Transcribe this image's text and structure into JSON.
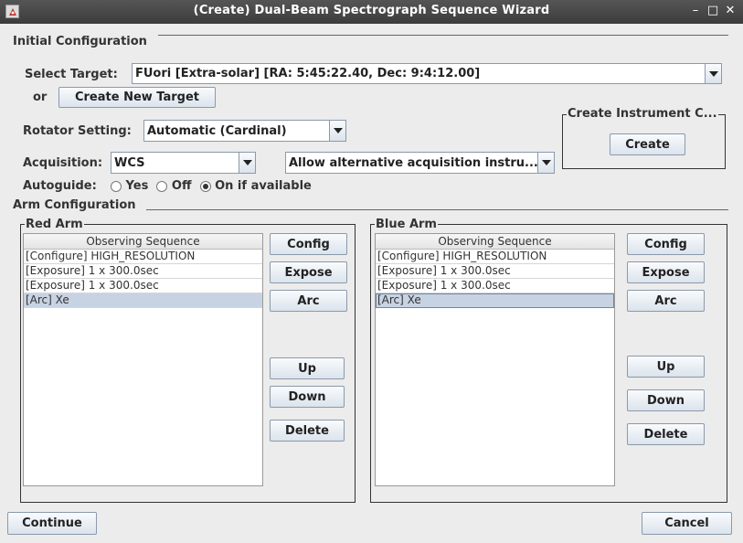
{
  "window": {
    "title": "(Create) Dual-Beam Spectrograph Sequence Wizard",
    "minimize": "–",
    "maximize": "□",
    "close": "✕"
  },
  "initial_config": {
    "heading": "Initial Configuration",
    "select_target_label": "Select Target:",
    "target_value": "FUori [Extra-solar] [RA:  5:45:22.40, Dec:  9:4:12.00]",
    "or_label": "or",
    "create_new_target": "Create New Target",
    "rotator_label": "Rotator Setting:",
    "rotator_value": "Automatic (Cardinal)",
    "acquisition_label": "Acquisition:",
    "acquisition_value": "WCS",
    "alt_acquisition_value": "Allow alternative acquisition instru...",
    "autoguide_label": "Autoguide:",
    "autoguide_options": [
      "Yes",
      "Off",
      "On if available"
    ],
    "autoguide_selected": "On if available",
    "create_instrument_title": "Create Instrument C...",
    "create_button": "Create"
  },
  "arm_config": {
    "heading": "Arm Configuration",
    "red": {
      "title": "Red Arm",
      "column": "Observing Sequence",
      "rows": [
        "[Configure] HIGH_RESOLUTION",
        "[Exposure] 1 x 300.0sec",
        "[Exposure] 1 x 300.0sec",
        "[Arc] Xe"
      ],
      "selected_index": 3,
      "buttons": {
        "config": "Config",
        "expose": "Expose",
        "arc": "Arc",
        "up": "Up",
        "down": "Down",
        "delete": "Delete"
      }
    },
    "blue": {
      "title": "Blue Arm",
      "column": "Observing Sequence",
      "rows": [
        "[Configure] HIGH_RESOLUTION",
        "[Exposure] 1 x 300.0sec",
        "[Exposure] 1 x 300.0sec",
        "[Arc] Xe"
      ],
      "selected_index": 3,
      "buttons": {
        "config": "Config",
        "expose": "Expose",
        "arc": "Arc",
        "up": "Up",
        "down": "Down",
        "delete": "Delete"
      }
    }
  },
  "footer": {
    "continue": "Continue",
    "cancel": "Cancel"
  }
}
